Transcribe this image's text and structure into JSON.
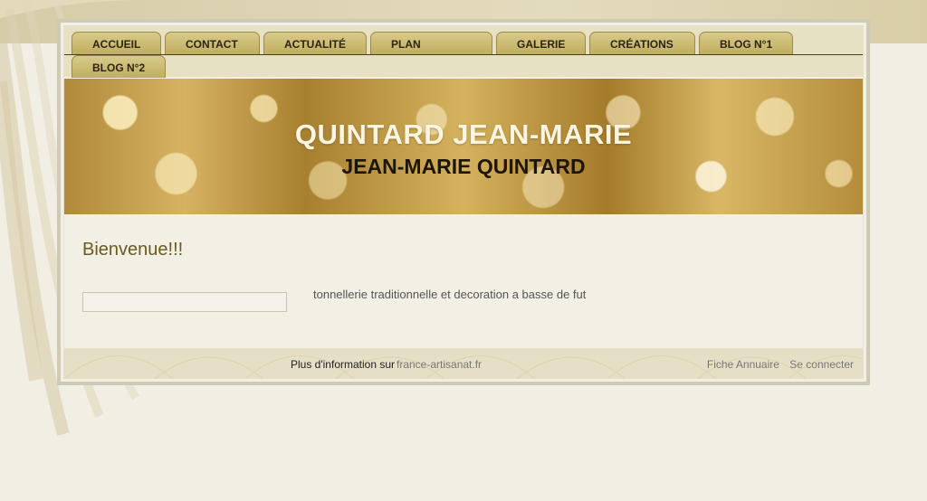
{
  "nav": {
    "tabs": [
      {
        "label": "ACCUEIL"
      },
      {
        "label": "CONTACT"
      },
      {
        "label": "ACTUALITÉ"
      },
      {
        "label": "PLAN"
      },
      {
        "label": "GALERIE"
      },
      {
        "label": "CRÉATIONS"
      },
      {
        "label": "BLOG N°1"
      },
      {
        "label": "BLOG N°2"
      }
    ]
  },
  "banner": {
    "title": "QUINTARD JEAN-MARIE",
    "subtitle": "JEAN-MARIE QUINTARD"
  },
  "main": {
    "welcome": "Bienvenue!!!",
    "description": "tonnellerie traditionnelle et decoration a basse de fut"
  },
  "footer": {
    "info_text": "Plus d'information sur",
    "info_link": "france-artisanat.fr",
    "fiche_annuaire": "Fiche Annuaire",
    "se_connecter": "Se connecter"
  },
  "colors": {
    "tab_gold": "#c9b872",
    "title_cream": "#fbf5e2",
    "welcome_olive": "#6b5a20",
    "page_bg": "#f1eee3"
  }
}
